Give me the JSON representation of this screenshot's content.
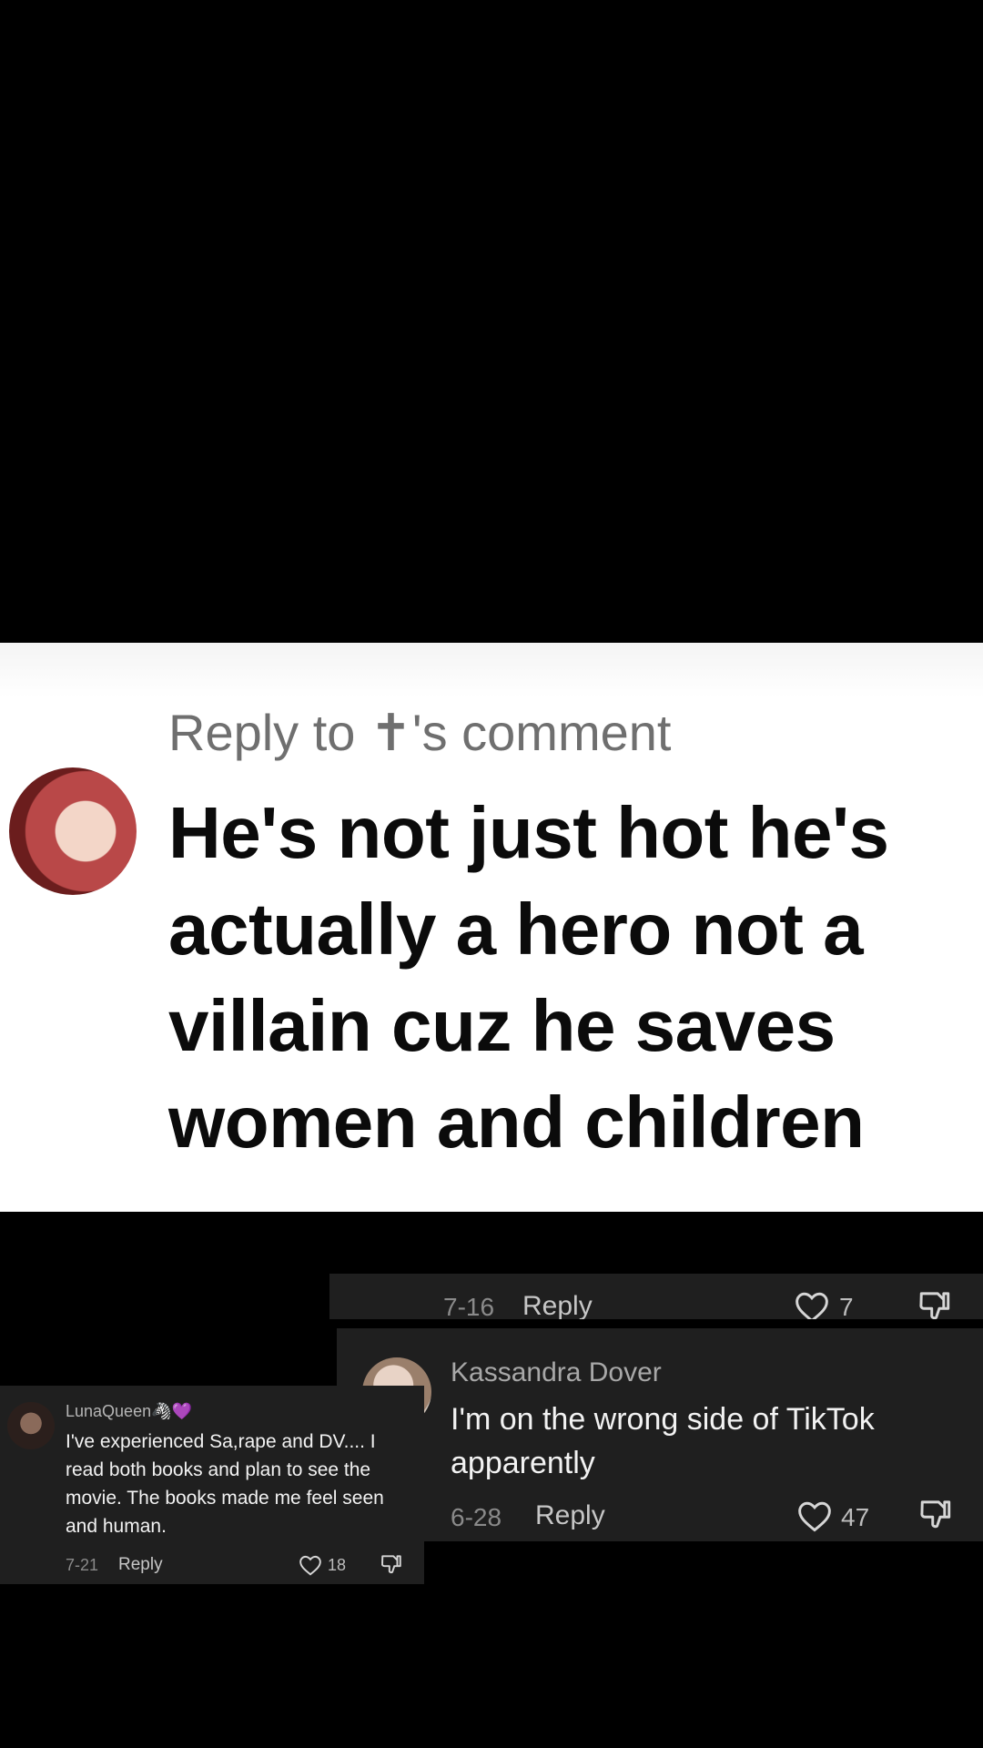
{
  "reply_card": {
    "header": "Reply to ✝'s comment",
    "comment": "He's not just hot he's actually a hero not a villain cuz he saves women and children"
  },
  "top_comment_footer": {
    "date": "7-16",
    "reply_label": "Reply",
    "likes": "7"
  },
  "kassandra_comment": {
    "username": "Kassandra Dover",
    "text": "I'm on the wrong side of TikTok apparently",
    "date": "6-28",
    "reply_label": "Reply",
    "likes": "47"
  },
  "luna_comment": {
    "username": "LunaQueen🦓💜",
    "text": "I've experienced Sa,rape and DV.... I read both books and plan to see the movie. The books made me feel seen and human.",
    "date": "7-21",
    "reply_label": "Reply",
    "likes": "18"
  },
  "icons": {
    "like": "heart-outline-icon",
    "dislike": "thumbs-down-icon"
  },
  "colors": {
    "card_bg": "#ffffff",
    "comment_box_bg": "#1f1f1f",
    "page_bg": "#000000"
  }
}
